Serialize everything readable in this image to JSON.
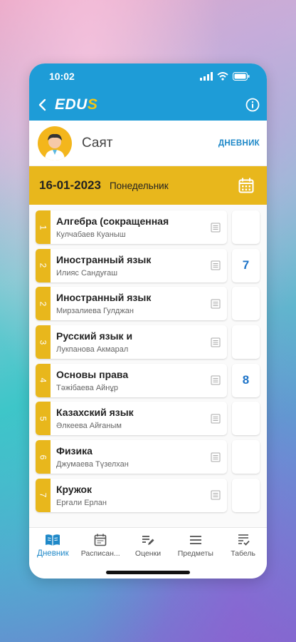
{
  "status": {
    "time": "10:02"
  },
  "header": {
    "logo_white": "EDU",
    "logo_yellow": "S"
  },
  "profile": {
    "name": "Саят",
    "diary_link": "ДНЕВНИК"
  },
  "datebar": {
    "date": "16-01-2023",
    "weekday": "Понедельник"
  },
  "lessons": [
    {
      "num": "1",
      "subject": "Алгебра (сокращенная",
      "teacher": "Кулчабаев Куаныш",
      "grade": ""
    },
    {
      "num": "2",
      "subject": "Иностранный язык",
      "teacher": "Илияс Сандуғаш",
      "grade": "7"
    },
    {
      "num": "2",
      "subject": "Иностранный язык",
      "teacher": "Мирзалиева Гулджан",
      "grade": ""
    },
    {
      "num": "3",
      "subject": "Русский язык и",
      "teacher": "Лукпанова Акмарал",
      "grade": ""
    },
    {
      "num": "4",
      "subject": "Основы права",
      "teacher": "Тәжібаева Айнұр",
      "grade": "8"
    },
    {
      "num": "5",
      "subject": "Казахский язык",
      "teacher": "Әлкеева Айғаным",
      "grade": ""
    },
    {
      "num": "6",
      "subject": "Физика",
      "teacher": "Джумаева Түзелхан",
      "grade": ""
    },
    {
      "num": "7",
      "subject": "Кружок",
      "teacher": "Ерғали Ерлан",
      "grade": ""
    }
  ],
  "tabs": [
    {
      "label": "Дневник",
      "icon": "book-icon",
      "active": true
    },
    {
      "label": "Расписан...",
      "icon": "calendar-icon",
      "active": false
    },
    {
      "label": "Оценки",
      "icon": "edit-list-icon",
      "active": false
    },
    {
      "label": "Предметы",
      "icon": "menu-icon",
      "active": false
    },
    {
      "label": "Табель",
      "icon": "checklist-icon",
      "active": false
    }
  ],
  "colors": {
    "primary": "#1e9cd7",
    "accent": "#e8b71c",
    "grade": "#1e74c8"
  }
}
